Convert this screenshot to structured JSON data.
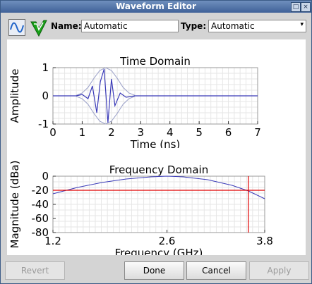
{
  "window": {
    "title": "Waveform Editor",
    "controls": [
      "□",
      "×"
    ]
  },
  "toolbar": {
    "name_label": "Name:",
    "name_value": "Automatic",
    "type_label": "Type:",
    "type_value": "Automatic",
    "icons": [
      "waveform-icon",
      "check-icon"
    ]
  },
  "buttons": {
    "revert": "Revert",
    "done": "Done",
    "cancel": "Cancel",
    "apply": "Apply"
  },
  "chart_data": [
    {
      "type": "line",
      "title": "Time Domain",
      "xlabel": "Time (ns)",
      "ylabel": "Amplitude",
      "xlim": [
        0,
        7
      ],
      "ylim": [
        -1,
        1
      ],
      "xticks": [
        0,
        1,
        2,
        3,
        4,
        5,
        6,
        7
      ],
      "yticks": [
        1,
        0,
        -1
      ],
      "grid": true,
      "series": [
        {
          "values_desc": "gaussian-modulated sinusoid pulse centered at ~1.8 ns, peak ~0.95, envelope ±1",
          "x": [
            0,
            0.8,
            1.0,
            1.2,
            1.35,
            1.5,
            1.62,
            1.75,
            1.88,
            2.0,
            2.12,
            2.3,
            2.5,
            2.8,
            7
          ],
          "y": [
            0,
            0.0,
            0.05,
            -0.1,
            0.35,
            -0.6,
            0.5,
            0.95,
            -0.95,
            0.6,
            -0.35,
            0.1,
            -0.05,
            0.0,
            0
          ]
        }
      ],
      "envelope": {
        "x": [
          0.8,
          1.0,
          1.2,
          1.4,
          1.6,
          1.8,
          2.0,
          2.2,
          2.4,
          2.6,
          2.8
        ],
        "y": [
          0.02,
          0.1,
          0.3,
          0.62,
          0.9,
          1.0,
          0.9,
          0.62,
          0.3,
          0.1,
          0.02
        ]
      }
    },
    {
      "type": "line",
      "title": "Frequency Domain",
      "xlabel": "Frequency (GHz)",
      "ylabel": "Magnitude (dBa)",
      "xlim": [
        1.2,
        3.8
      ],
      "ylim": [
        -80,
        0
      ],
      "xticks": [
        1.2,
        2.6,
        3.8
      ],
      "yticks": [
        0,
        -20,
        -40,
        -60,
        -80
      ],
      "grid": true,
      "series": [
        {
          "x": [
            1.2,
            1.5,
            1.8,
            2.1,
            2.4,
            2.6,
            2.8,
            3.1,
            3.4,
            3.6,
            3.8
          ],
          "y": [
            -25,
            -16,
            -9,
            -4,
            -1,
            0,
            -1,
            -5,
            -13,
            -21,
            -32
          ]
        }
      ],
      "markers": {
        "hline_y": -20,
        "vline_x": 3.6,
        "color": "#e00000"
      }
    }
  ],
  "colors": {
    "trace": "#3a3ab8",
    "envelope": "#9aa0c8",
    "marker": "#e00000"
  }
}
